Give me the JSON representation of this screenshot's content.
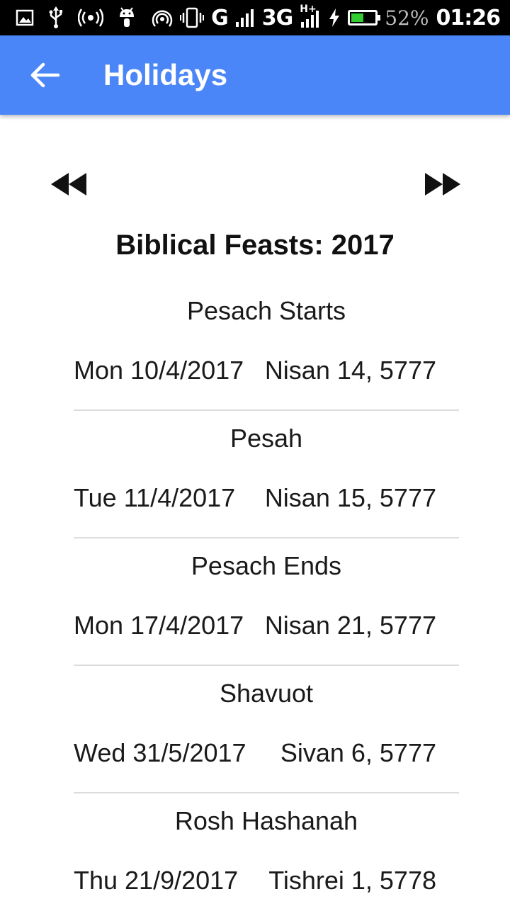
{
  "status_bar": {
    "battery_percent": "52%",
    "battery_level": 0.52,
    "time": "01:26",
    "network_g": "G",
    "network_3g": "3G",
    "network_hplus": "H+",
    "icons": [
      "image-icon",
      "usb-icon",
      "hotspot-icon",
      "android-icon",
      "wifi-hotspot-icon",
      "vibrate-icon",
      "signal-icon",
      "charging-icon",
      "battery-icon"
    ]
  },
  "app_bar": {
    "title": "Holidays",
    "back_icon": "arrow-left-icon",
    "color": "#4a86f7"
  },
  "nav": {
    "prev_icon": "fast-rewind-icon",
    "next_icon": "fast-forward-icon"
  },
  "heading": "Biblical Feasts: 2017",
  "holidays": [
    {
      "name": "Pesach Starts",
      "gregorian": "Mon 10/4/2017",
      "hebrew": "Nisan 14, 5777"
    },
    {
      "name": "Pesah",
      "gregorian": "Tue 11/4/2017",
      "hebrew": "Nisan 15, 5777"
    },
    {
      "name": "Pesach Ends",
      "gregorian": "Mon 17/4/2017",
      "hebrew": "Nisan 21, 5777"
    },
    {
      "name": "Shavuot",
      "gregorian": "Wed 31/5/2017",
      "hebrew": "Sivan 6, 5777"
    },
    {
      "name": "Rosh Hashanah",
      "gregorian": "Thu 21/9/2017",
      "hebrew": "Tishrei 1, 5778"
    }
  ]
}
